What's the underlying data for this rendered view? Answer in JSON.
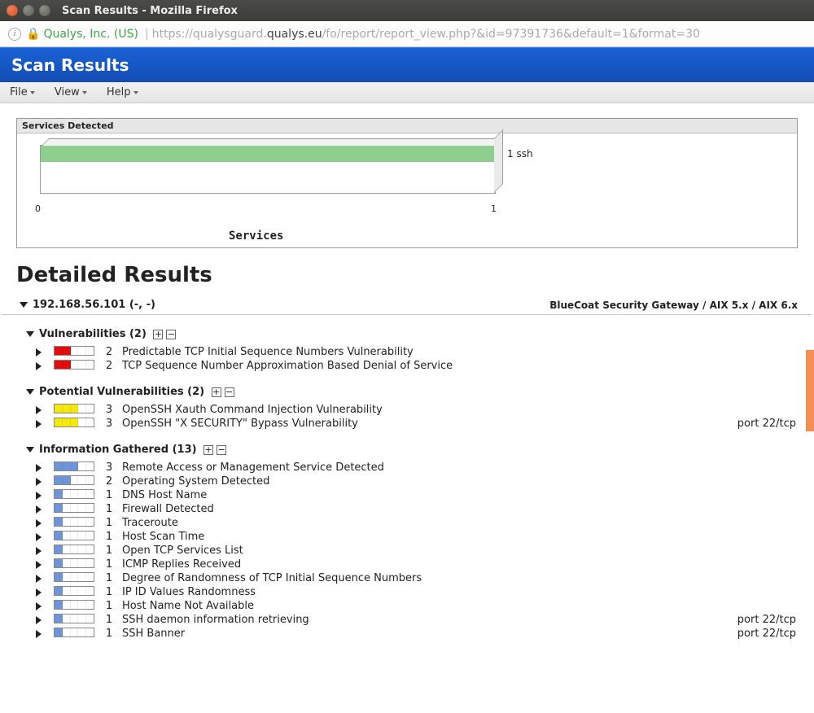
{
  "window": {
    "title": "Scan Results - Mozilla Firefox"
  },
  "address": {
    "org": "Qualys, Inc. (US)",
    "url_sub1": "https://qualysguard.",
    "url_dom": "qualys.eu",
    "url_sub2": "/fo/report/report_view.php?&id=97391736&default=1&format=30"
  },
  "header": {
    "title": "Scan Results"
  },
  "menus": {
    "file": "File",
    "view": "View",
    "help": "Help"
  },
  "chart_data": {
    "type": "bar",
    "title": "Services Detected",
    "xlabel": "Services",
    "categories": [
      "ssh"
    ],
    "values": [
      1
    ],
    "xlim": [
      0,
      1
    ],
    "bar_label": "1 ssh",
    "tick0": "0",
    "tick1": "1"
  },
  "detailed_heading": "Detailed Results",
  "host": {
    "ip_line": "192.168.56.101 (-, -)",
    "os_line": "BlueCoat Security Gateway / AIX 5.x / AIX 6.x"
  },
  "sections": {
    "vuln": {
      "label": "Vulnerabilities (2)",
      "items": [
        {
          "level": 2,
          "color": "red",
          "segments": 2,
          "title": "Predictable TCP Initial Sequence Numbers Vulnerability",
          "port": ""
        },
        {
          "level": 2,
          "color": "red",
          "segments": 2,
          "title": "TCP Sequence Number Approximation Based Denial of Service",
          "port": ""
        }
      ]
    },
    "potvuln": {
      "label": "Potential Vulnerabilities (2)",
      "items": [
        {
          "level": 3,
          "color": "yellow",
          "segments": 3,
          "title": "OpenSSH Xauth Command Injection Vulnerability",
          "port": ""
        },
        {
          "level": 3,
          "color": "yellow",
          "segments": 3,
          "title": "OpenSSH \"X SECURITY\" Bypass Vulnerability",
          "port": "port 22/tcp"
        }
      ]
    },
    "info": {
      "label": "Information Gathered (13)",
      "items": [
        {
          "level": 3,
          "color": "blue",
          "segments": 3,
          "title": "Remote Access or Management Service Detected",
          "port": ""
        },
        {
          "level": 2,
          "color": "blue",
          "segments": 2,
          "title": "Operating System Detected",
          "port": ""
        },
        {
          "level": 1,
          "color": "blue",
          "segments": 1,
          "title": "DNS Host Name",
          "port": ""
        },
        {
          "level": 1,
          "color": "blue",
          "segments": 1,
          "title": "Firewall Detected",
          "port": ""
        },
        {
          "level": 1,
          "color": "blue",
          "segments": 1,
          "title": "Traceroute",
          "port": ""
        },
        {
          "level": 1,
          "color": "blue",
          "segments": 1,
          "title": "Host Scan Time",
          "port": ""
        },
        {
          "level": 1,
          "color": "blue",
          "segments": 1,
          "title": "Open TCP Services List",
          "port": ""
        },
        {
          "level": 1,
          "color": "blue",
          "segments": 1,
          "title": "ICMP Replies Received",
          "port": ""
        },
        {
          "level": 1,
          "color": "blue",
          "segments": 1,
          "title": "Degree of Randomness of TCP Initial Sequence Numbers",
          "port": ""
        },
        {
          "level": 1,
          "color": "blue",
          "segments": 1,
          "title": "IP ID Values Randomness",
          "port": ""
        },
        {
          "level": 1,
          "color": "blue",
          "segments": 1,
          "title": "Host Name Not Available",
          "port": ""
        },
        {
          "level": 1,
          "color": "blue",
          "segments": 1,
          "title": "SSH daemon information retrieving",
          "port": "port 22/tcp"
        },
        {
          "level": 1,
          "color": "blue",
          "segments": 1,
          "title": "SSH Banner",
          "port": "port 22/tcp"
        }
      ]
    }
  }
}
